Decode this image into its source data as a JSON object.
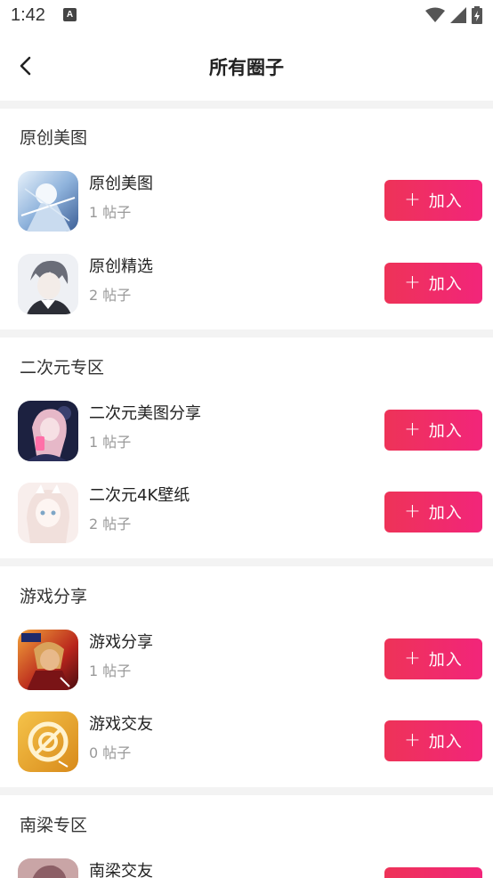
{
  "status": {
    "time": "1:42",
    "notif_letter": "A"
  },
  "header": {
    "title": "所有圈子"
  },
  "join_plus": "+",
  "sections": [
    {
      "title": "原创美图",
      "items": [
        {
          "name": "原创美图",
          "count": "1 帖子",
          "button": "加入"
        },
        {
          "name": "原创精选",
          "count": "2 帖子",
          "button": "加入"
        }
      ]
    },
    {
      "title": "二次元专区",
      "items": [
        {
          "name": "二次元美图分享",
          "count": "1 帖子",
          "button": "加入"
        },
        {
          "name": "二次元4K壁纸",
          "count": "2 帖子",
          "button": "加入"
        }
      ]
    },
    {
      "title": "游戏分享",
      "items": [
        {
          "name": "游戏分享",
          "count": "1 帖子",
          "button": "加入"
        },
        {
          "name": "游戏交友",
          "count": "0 帖子",
          "button": "加入"
        }
      ]
    },
    {
      "title": "南梁专区",
      "items": [
        {
          "name": "南梁交友",
          "count": "",
          "button": ""
        }
      ]
    }
  ],
  "colors": {
    "accent_start": "#ee3358",
    "accent_end": "#f2257a",
    "divider": "#f3f3f3"
  }
}
